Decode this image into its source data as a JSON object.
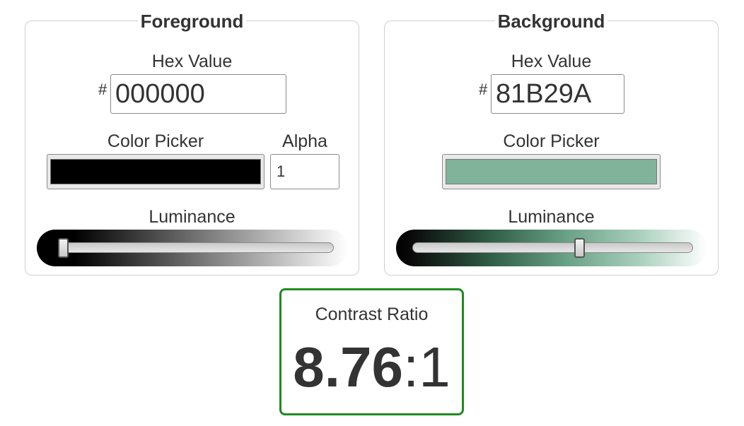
{
  "foreground": {
    "title": "Foreground",
    "hex_label": "Hex Value",
    "hash": "#",
    "hex_value": "000000",
    "picker_label": "Color Picker",
    "picker_color": "#000000",
    "alpha_label": "Alpha",
    "alpha_value": "1",
    "luminance_label": "Luminance",
    "luminance_level": 0.0
  },
  "background": {
    "title": "Background",
    "hex_label": "Hex Value",
    "hash": "#",
    "hex_value": "81B29A",
    "picker_label": "Color Picker",
    "picker_color": "#81B29A",
    "luminance_label": "Luminance",
    "luminance_level": 0.6
  },
  "contrast": {
    "label": "Contrast Ratio",
    "ratio": "8.76",
    "separator_suffix": ":1",
    "border_color": "#1e8c1e"
  }
}
